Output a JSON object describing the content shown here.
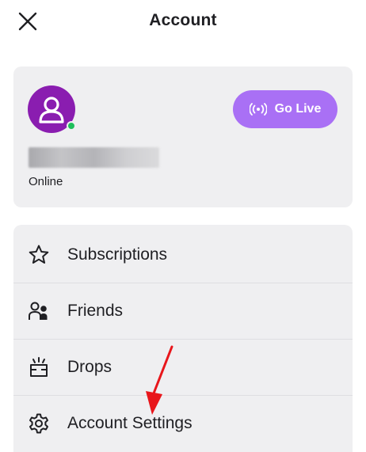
{
  "header": {
    "title": "Account"
  },
  "profile": {
    "status": "Online",
    "go_live_label": "Go Live",
    "avatar_color": "#8a1db0",
    "online_color": "#1fbf5b"
  },
  "menu": {
    "items": [
      {
        "label": "Subscriptions",
        "icon": "star-icon"
      },
      {
        "label": "Friends",
        "icon": "friends-icon"
      },
      {
        "label": "Drops",
        "icon": "drops-icon"
      },
      {
        "label": "Account Settings",
        "icon": "gear-icon"
      }
    ]
  },
  "colors": {
    "accent": "#a970f5",
    "card_bg": "#efeff1",
    "annotation_arrow": "#e8161b"
  }
}
